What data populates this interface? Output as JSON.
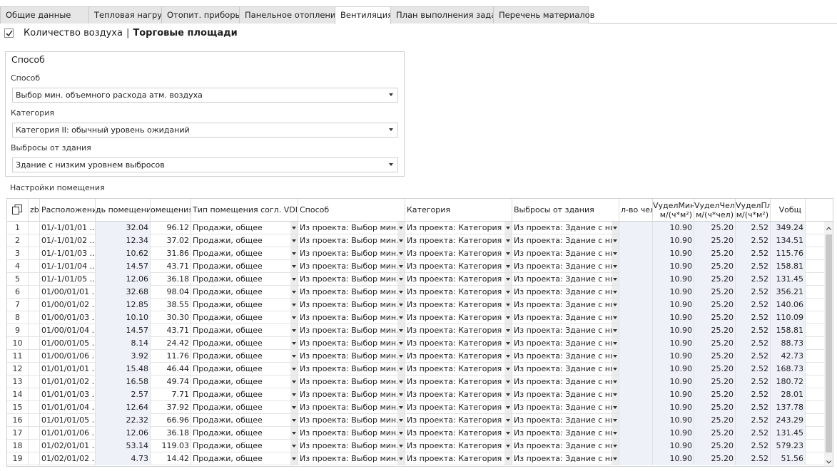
{
  "tabs": [
    {
      "label": "Общие данные"
    },
    {
      "label": "Тепловая нагрузка SP"
    },
    {
      "label": "Отопит. приборы"
    },
    {
      "label": "Панельное отопление"
    },
    {
      "label": "Вентиляция"
    },
    {
      "label": "План выполнения задач"
    },
    {
      "label": "Перечень материалов"
    }
  ],
  "active_tab": "Вентиляция",
  "header": {
    "checkbox_label": "Количество воздуха",
    "separator": "|",
    "title": "Торговые площади"
  },
  "group": {
    "title": "Способ",
    "fields": [
      {
        "label": "Способ",
        "value": "Выбор мин. объемного расхода атм. воздуха"
      },
      {
        "label": "Категория",
        "value": "Категория II: обычный уровень ожиданий"
      },
      {
        "label": "Выбросы от здания",
        "value": "Здание с низким уровнем выбросов"
      }
    ]
  },
  "section_label": "Настройки помещения",
  "grid": {
    "columns": {
      "zb": "zb",
      "location": "Расположение",
      "area": "дь помещения",
      "volume": "омещения",
      "type": "Тип помещения согл. VDI 20",
      "method": "Способ",
      "category": "Категория",
      "emissions": "Выбросы от здания",
      "persons": "л-во чел.",
      "vmin": [
        "VуделМин",
        "м/(ч*м²)"
      ],
      "vpers": [
        "VуделЧел",
        "м/(ч*чел)"
      ],
      "varea": [
        "VуделПл",
        "м/(ч*м²)"
      ],
      "vtotal": "Vобщ"
    },
    "rows": [
      {
        "n": "1",
        "loc": "01/-1/01/01 ...",
        "area": "32.04",
        "vol": "96.12",
        "type": "Продажи, общее",
        "method": "Из проекта: Выбор мин. ...",
        "cat": "Из проекта: Категория II:...",
        "emis": "Из проекта: Здание с ни...",
        "pers": "",
        "vmin": "10.90",
        "vpers": "25.20",
        "varea": "2.52",
        "vtot": "349.24"
      },
      {
        "n": "2",
        "loc": "01/-1/01/02 ...",
        "area": "12.34",
        "vol": "37.02",
        "type": "Продажи, общее",
        "method": "Из проекта: Выбор мин. ...",
        "cat": "Из проекта: Категория II:...",
        "emis": "Из проекта: Здание с ни...",
        "pers": "",
        "vmin": "10.90",
        "vpers": "25.20",
        "varea": "2.52",
        "vtot": "134.51"
      },
      {
        "n": "3",
        "loc": "01/-1/01/03 ...",
        "area": "10.62",
        "vol": "31.86",
        "type": "Продажи, общее",
        "method": "Из проекта: Выбор мин. ...",
        "cat": "Из проекта: Категория II:...",
        "emis": "Из проекта: Здание с ни...",
        "pers": "",
        "vmin": "10.90",
        "vpers": "25.20",
        "varea": "2.52",
        "vtot": "115.76"
      },
      {
        "n": "4",
        "loc": "01/-1/01/04 ...",
        "area": "14.57",
        "vol": "43.71",
        "type": "Продажи, общее",
        "method": "Из проекта: Выбор мин. ...",
        "cat": "Из проекта: Категория II:...",
        "emis": "Из проекта: Здание с ни...",
        "pers": "",
        "vmin": "10.90",
        "vpers": "25.20",
        "varea": "2.52",
        "vtot": "158.81"
      },
      {
        "n": "5",
        "loc": "01/-1/01/05 ...",
        "area": "12.06",
        "vol": "36.18",
        "type": "Продажи, общее",
        "method": "Из проекта: Выбор мин. ...",
        "cat": "Из проекта: Категория II:...",
        "emis": "Из проекта: Здание с ни...",
        "pers": "",
        "vmin": "10.90",
        "vpers": "25.20",
        "varea": "2.52",
        "vtot": "131.45"
      },
      {
        "n": "6",
        "loc": "01/00/01/01 ...",
        "area": "32.68",
        "vol": "98.04",
        "type": "Продажи, общее",
        "method": "Из проекта: Выбор мин. ...",
        "cat": "Из проекта: Категория II:...",
        "emis": "Из проекта: Здание с ни...",
        "pers": "",
        "vmin": "10.90",
        "vpers": "25.20",
        "varea": "2.52",
        "vtot": "356.21"
      },
      {
        "n": "7",
        "loc": "01/00/01/02 ...",
        "area": "12.85",
        "vol": "38.55",
        "type": "Продажи, общее",
        "method": "Из проекта: Выбор мин. ...",
        "cat": "Из проекта: Категория II:...",
        "emis": "Из проекта: Здание с ни...",
        "pers": "",
        "vmin": "10.90",
        "vpers": "25.20",
        "varea": "2.52",
        "vtot": "140.06"
      },
      {
        "n": "8",
        "loc": "01/00/01/03 ...",
        "area": "10.10",
        "vol": "30.30",
        "type": "Продажи, общее",
        "method": "Из проекта: Выбор мин. ...",
        "cat": "Из проекта: Категория II:...",
        "emis": "Из проекта: Здание с ни...",
        "pers": "",
        "vmin": "10.90",
        "vpers": "25.20",
        "varea": "2.52",
        "vtot": "110.09"
      },
      {
        "n": "9",
        "loc": "01/00/01/04 ...",
        "area": "14.57",
        "vol": "43.71",
        "type": "Продажи, общее",
        "method": "Из проекта: Выбор мин. ...",
        "cat": "Из проекта: Категория II:...",
        "emis": "Из проекта: Здание с ни...",
        "pers": "",
        "vmin": "10.90",
        "vpers": "25.20",
        "varea": "2.52",
        "vtot": "158.81"
      },
      {
        "n": "10",
        "loc": "01/00/01/05 ...",
        "area": "8.14",
        "vol": "24.42",
        "type": "Продажи, общее",
        "method": "Из проекта: Выбор мин. ...",
        "cat": "Из проекта: Категория II:...",
        "emis": "Из проекта: Здание с ни...",
        "pers": "",
        "vmin": "10.90",
        "vpers": "25.20",
        "varea": "2.52",
        "vtot": "88.73"
      },
      {
        "n": "11",
        "loc": "01/00/01/06 ...",
        "area": "3.92",
        "vol": "11.76",
        "type": "Продажи, общее",
        "method": "Из проекта: Выбор мин. ...",
        "cat": "Из проекта: Категория II:...",
        "emis": "Из проекта: Здание с ни...",
        "pers": "",
        "vmin": "10.90",
        "vpers": "25.20",
        "varea": "2.52",
        "vtot": "42.73"
      },
      {
        "n": "12",
        "loc": "01/01/01/01 ...",
        "area": "15.48",
        "vol": "46.44",
        "type": "Продажи, общее",
        "method": "Из проекта: Выбор мин. ...",
        "cat": "Из проекта: Категория II:...",
        "emis": "Из проекта: Здание с ни...",
        "pers": "",
        "vmin": "10.90",
        "vpers": "25.20",
        "varea": "2.52",
        "vtot": "168.73"
      },
      {
        "n": "13",
        "loc": "01/01/01/02 ...",
        "area": "16.58",
        "vol": "49.74",
        "type": "Продажи, общее",
        "method": "Из проекта: Выбор мин. ...",
        "cat": "Из проекта: Категория II:...",
        "emis": "Из проекта: Здание с ни...",
        "pers": "",
        "vmin": "10.90",
        "vpers": "25.20",
        "varea": "2.52",
        "vtot": "180.72"
      },
      {
        "n": "14",
        "loc": "01/01/01/03 ...",
        "area": "2.57",
        "vol": "7.71",
        "type": "Продажи, общее",
        "method": "Из проекта: Выбор мин. ...",
        "cat": "Из проекта: Категория II:...",
        "emis": "Из проекта: Здание с ни...",
        "pers": "",
        "vmin": "10.90",
        "vpers": "25.20",
        "varea": "2.52",
        "vtot": "28.01"
      },
      {
        "n": "15",
        "loc": "01/01/01/04 ...",
        "area": "12.64",
        "vol": "37.92",
        "type": "Продажи, общее",
        "method": "Из проекта: Выбор мин. ...",
        "cat": "Из проекта: Категория II:...",
        "emis": "Из проекта: Здание с ни...",
        "pers": "",
        "vmin": "10.90",
        "vpers": "25.20",
        "varea": "2.52",
        "vtot": "137.78"
      },
      {
        "n": "16",
        "loc": "01/01/01/05 ...",
        "area": "22.32",
        "vol": "66.96",
        "type": "Продажи, общее",
        "method": "Из проекта: Выбор мин. ...",
        "cat": "Из проекта: Категория II:...",
        "emis": "Из проекта: Здание с ни...",
        "pers": "",
        "vmin": "10.90",
        "vpers": "25.20",
        "varea": "2.52",
        "vtot": "243.29"
      },
      {
        "n": "17",
        "loc": "01/01/01/06 ...",
        "area": "12.06",
        "vol": "36.18",
        "type": "Продажи, общее",
        "method": "Из проекта: Выбор мин. ...",
        "cat": "Из проекта: Категория II:...",
        "emis": "Из проекта: Здание с ни...",
        "pers": "",
        "vmin": "10.90",
        "vpers": "25.20",
        "varea": "2.52",
        "vtot": "131.45"
      },
      {
        "n": "18",
        "loc": "01/02/01/01 ...",
        "area": "53.14",
        "vol": "119.03",
        "type": "Продажи, общее",
        "method": "Из проекта: Выбор мин. ...",
        "cat": "Из проекта: Категория II:...",
        "emis": "Из проекта: Здание с ни...",
        "pers": "",
        "vmin": "10.90",
        "vpers": "25.20",
        "varea": "2.52",
        "vtot": "579.23"
      },
      {
        "n": "19",
        "loc": "01/02/01/02 ...",
        "area": "4.73",
        "vol": "14.42",
        "type": "Продажи, общее",
        "method": "Из проекта: Выбор мин. ...",
        "cat": "Из проекта: Категория II:...",
        "emis": "Из проекта: Здание с ни...",
        "pers": "",
        "vmin": "10.90",
        "vpers": "25.20",
        "varea": "2.52",
        "vtot": "51.56"
      }
    ]
  },
  "colors": {
    "shade": "#eef1f8",
    "tab_bg": "#e6e6e6",
    "border": "#cfcfcf"
  }
}
